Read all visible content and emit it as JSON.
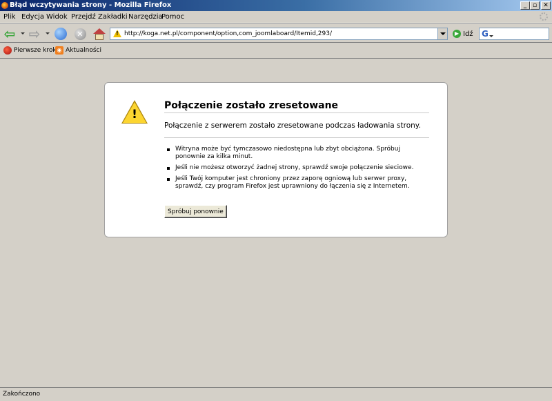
{
  "window": {
    "title": "Błąd wczytywania strony - Mozilla Firefox",
    "min_label": "_",
    "restore_label": "▫",
    "close_label": "✕"
  },
  "menu": [
    "Plik",
    "Edycja",
    "Widok",
    "Przejdź",
    "Zakładki",
    "Narzędzia",
    "Pomoc"
  ],
  "nav": {
    "url": "http://koga.net.pl/component/option,com_joomlaboard/Itemid,293/",
    "go_label": "Idź",
    "search_engine_letter": "G",
    "search_value": ""
  },
  "bookmarks": [
    {
      "label": "Pierwsze kroki",
      "icon": "firefox-icon"
    },
    {
      "label": "Aktualności",
      "icon": "rss-icon"
    }
  ],
  "error": {
    "title": "Połączenie zostało zresetowane",
    "short_desc": "Połączenie z serwerem zostało zresetowane podczas ładowania strony.",
    "bullets": [
      "Witryna może być tymczasowo niedostępna lub zbyt obciążona. Spróbuj ponownie za kilka minut.",
      "Jeśli nie możesz otworzyć żadnej strony, sprawdź swoje połączenie sieciowe.",
      "Jeśli Twój komputer jest chroniony przez zaporę ogniową lub serwer proxy, sprawdź, czy program Firefox jest uprawniony do łączenia się z Internetem."
    ],
    "retry_label": "Spróbuj ponownie"
  },
  "status": {
    "text": "Zakończono"
  },
  "colors": {
    "titlebar": "#0a246a",
    "chrome": "#d4d0c8",
    "warning": "#fcd530"
  }
}
